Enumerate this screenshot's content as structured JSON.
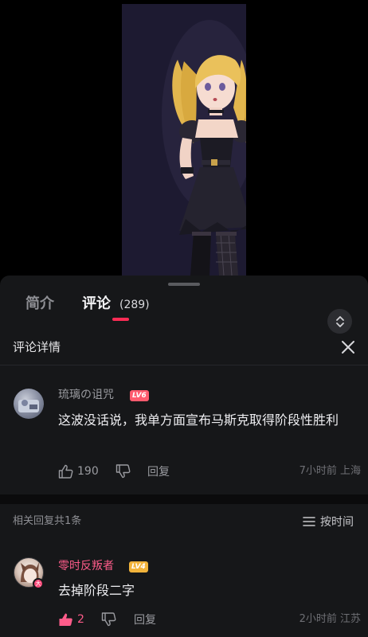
{
  "tabs": [
    {
      "label": "简介"
    },
    {
      "label": "评论",
      "count": "(289)"
    }
  ],
  "detail": {
    "title": "评论详情"
  },
  "main_comment": {
    "username": "琉璃の诅咒",
    "level": "LV6",
    "text": "这波没话说，我单方面宣布马斯克取得阶段性胜利",
    "likes": "190",
    "reply_label": "回复",
    "time": "7小时前",
    "location": "上海"
  },
  "related": {
    "count_text": "相关回复共1条",
    "sort_label": "按时间"
  },
  "reply_comment": {
    "username": "零时反叛者",
    "level": "LV4",
    "avatar_badge": "大",
    "text": "去掉阶段二字",
    "likes": "2",
    "reply_label": "回复",
    "time": "2小时前",
    "location": "江苏"
  },
  "colors": {
    "accent": "#fe2c55",
    "pink_username": "#fe5c8a",
    "level6": "#ff5b6e",
    "level4": "#f1b33b",
    "sheet_bg": "#161719"
  }
}
